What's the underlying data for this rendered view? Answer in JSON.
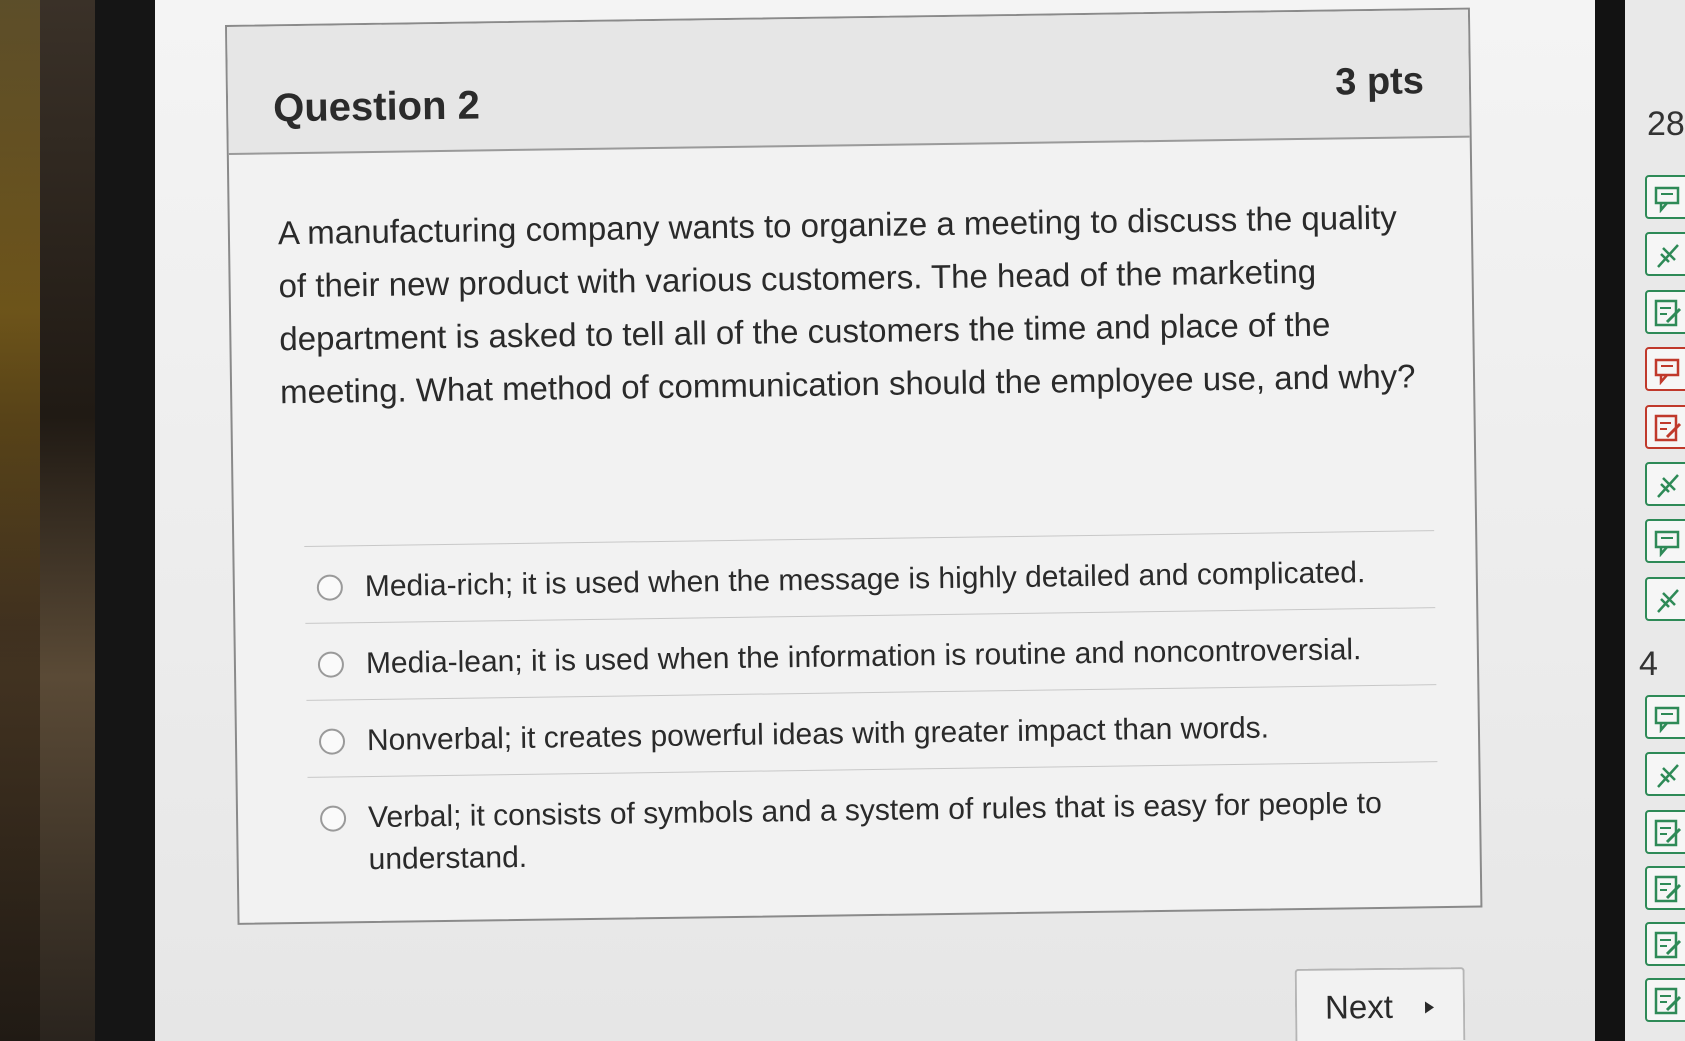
{
  "question": {
    "title": "Question 2",
    "points": "3 pts",
    "text": "A manufacturing company wants to organize a meeting to discuss the quality of their new product with various customers. The head of the marketing department is asked to tell all of the customers the time and place of the meeting. What method of communication should the employee use, and why?",
    "answers": [
      "Media-rich; it is used when the message is highly detailed and complicated.",
      "Media-lean; it is used when the information is routine and noncontroversial.",
      "Nonverbal; it creates powerful ideas with greater impact than words.",
      "Verbal; it consists of symbols and a system of rules that is easy for people to understand."
    ]
  },
  "navigation": {
    "next_label": "Next"
  },
  "side_panel": {
    "number_top": "28",
    "number_mid": "4",
    "icons": [
      "comment-icon",
      "flag-icon",
      "edit-icon",
      "comment-icon",
      "edit-icon",
      "flag-icon",
      "comment-icon",
      "flag-icon",
      "comment-icon",
      "flag-icon",
      "edit-icon",
      "edit-icon",
      "edit-icon",
      "edit-icon"
    ],
    "colors": {
      "green": "#2e8a57",
      "red": "#c0392b"
    }
  }
}
